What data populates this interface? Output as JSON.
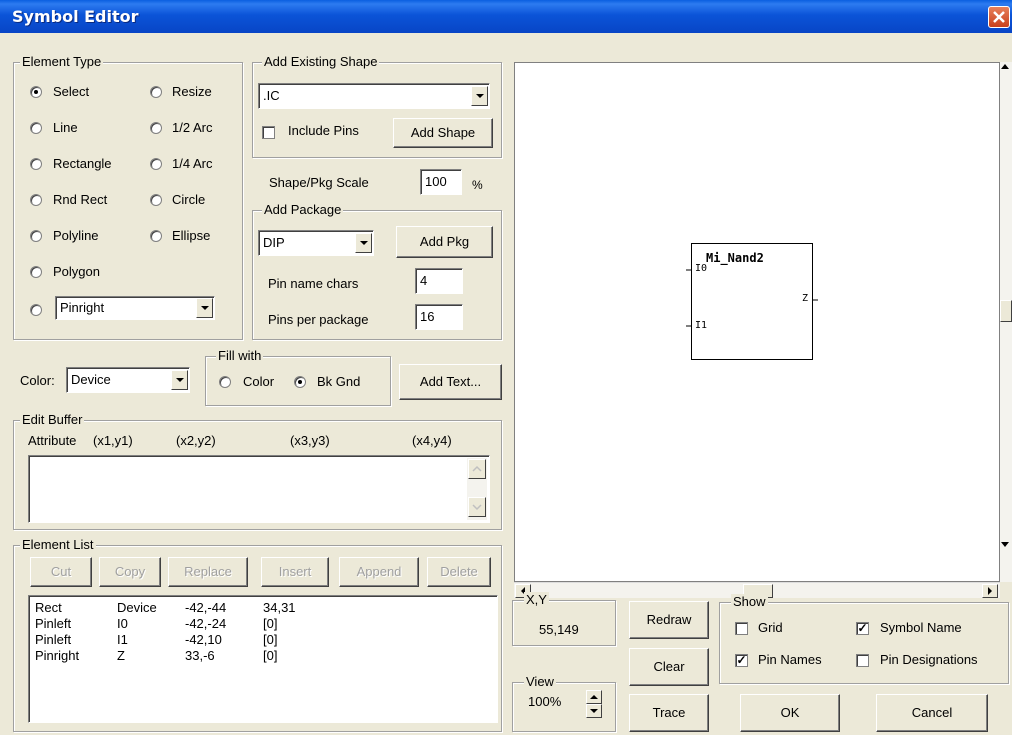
{
  "window": {
    "title": "Symbol Editor"
  },
  "element_type": {
    "label": "Element Type",
    "options": [
      {
        "label": "Select",
        "checked": true
      },
      {
        "label": "Resize",
        "checked": false
      },
      {
        "label": "Line",
        "checked": false
      },
      {
        "label": "1/2 Arc",
        "checked": false
      },
      {
        "label": "Rectangle",
        "checked": false
      },
      {
        "label": "1/4 Arc",
        "checked": false
      },
      {
        "label": "Rnd Rect",
        "checked": false
      },
      {
        "label": "Circle",
        "checked": false
      },
      {
        "label": "Polyline",
        "checked": false
      },
      {
        "label": "Ellipse",
        "checked": false
      },
      {
        "label": "Polygon",
        "checked": false
      }
    ],
    "pin_select_value": "Pinright"
  },
  "add_shape": {
    "label": "Add Existing Shape",
    "shape_value": ".IC",
    "include_pins_label": "Include Pins",
    "include_pins_checked": false,
    "add_button": "Add Shape"
  },
  "scale": {
    "label": "Shape/Pkg Scale",
    "value": "100",
    "unit": "%"
  },
  "package": {
    "label": "Add Package",
    "value": "DIP",
    "add_button": "Add Pkg",
    "pin_name_chars_label": "Pin name chars",
    "pin_name_chars": "4",
    "pins_per_package_label": "Pins per package",
    "pins_per_package": "16"
  },
  "color": {
    "label": "Color:",
    "value": "Device"
  },
  "fill": {
    "label": "Fill with",
    "color_label": "Color",
    "bkgnd_label": "Bk Gnd",
    "selected": "Bk Gnd"
  },
  "add_text_button": "Add Text...",
  "edit_buffer": {
    "label": "Edit Buffer",
    "headers": [
      "Attribute",
      "(x1,y1)",
      "(x2,y2)",
      "(x3,y3)",
      "(x4,y4)"
    ]
  },
  "element_list": {
    "label": "Element List",
    "buttons": [
      "Cut",
      "Copy",
      "Replace",
      "Insert",
      "Append",
      "Delete"
    ],
    "rows": [
      [
        "Rect",
        "Device",
        "-42,-44",
        "34,31"
      ],
      [
        "Pinleft",
        "I0",
        "-42,-24",
        "[0]"
      ],
      [
        "Pinleft",
        "I1",
        "-42,10",
        "[0]"
      ],
      [
        "Pinright",
        "Z",
        "33,-6",
        "[0]"
      ]
    ]
  },
  "symbol": {
    "name": "Mi_Nand2",
    "pins": [
      "I0",
      "I1",
      "Z"
    ]
  },
  "xy": {
    "label": "X,Y",
    "value": "55,149"
  },
  "view": {
    "label": "View",
    "value": "100%"
  },
  "buttons": {
    "redraw": "Redraw",
    "clear": "Clear",
    "trace": "Trace",
    "ok": "OK",
    "cancel": "Cancel"
  },
  "show": {
    "label": "Show",
    "grid": {
      "label": "Grid",
      "checked": false
    },
    "symbol_name": {
      "label": "Symbol Name",
      "checked": true
    },
    "pin_names": {
      "label": "Pin Names",
      "checked": true
    },
    "pin_designations": {
      "label": "Pin Designations",
      "checked": false
    }
  }
}
